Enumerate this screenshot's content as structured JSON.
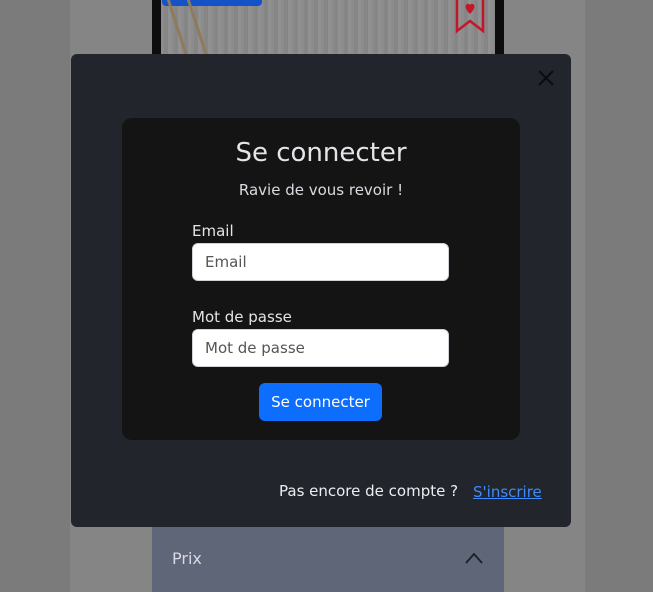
{
  "colors": {
    "accent": "#0d6efd",
    "modal_bg": "#22252b",
    "card_bg": "#141414",
    "bookmark": "#c3162a"
  },
  "background": {
    "accordion_label": "Prix"
  },
  "modal": {
    "title": "Se connecter",
    "subtitle": "Ravie de vous revoir !",
    "email_label": "Email",
    "email_placeholder": "Email",
    "password_label": "Mot de passe",
    "password_placeholder": "Mot de passe",
    "submit_label": "Se connecter",
    "footer_text": "Pas encore de compte ?",
    "signup_link": "S'inscrire"
  }
}
